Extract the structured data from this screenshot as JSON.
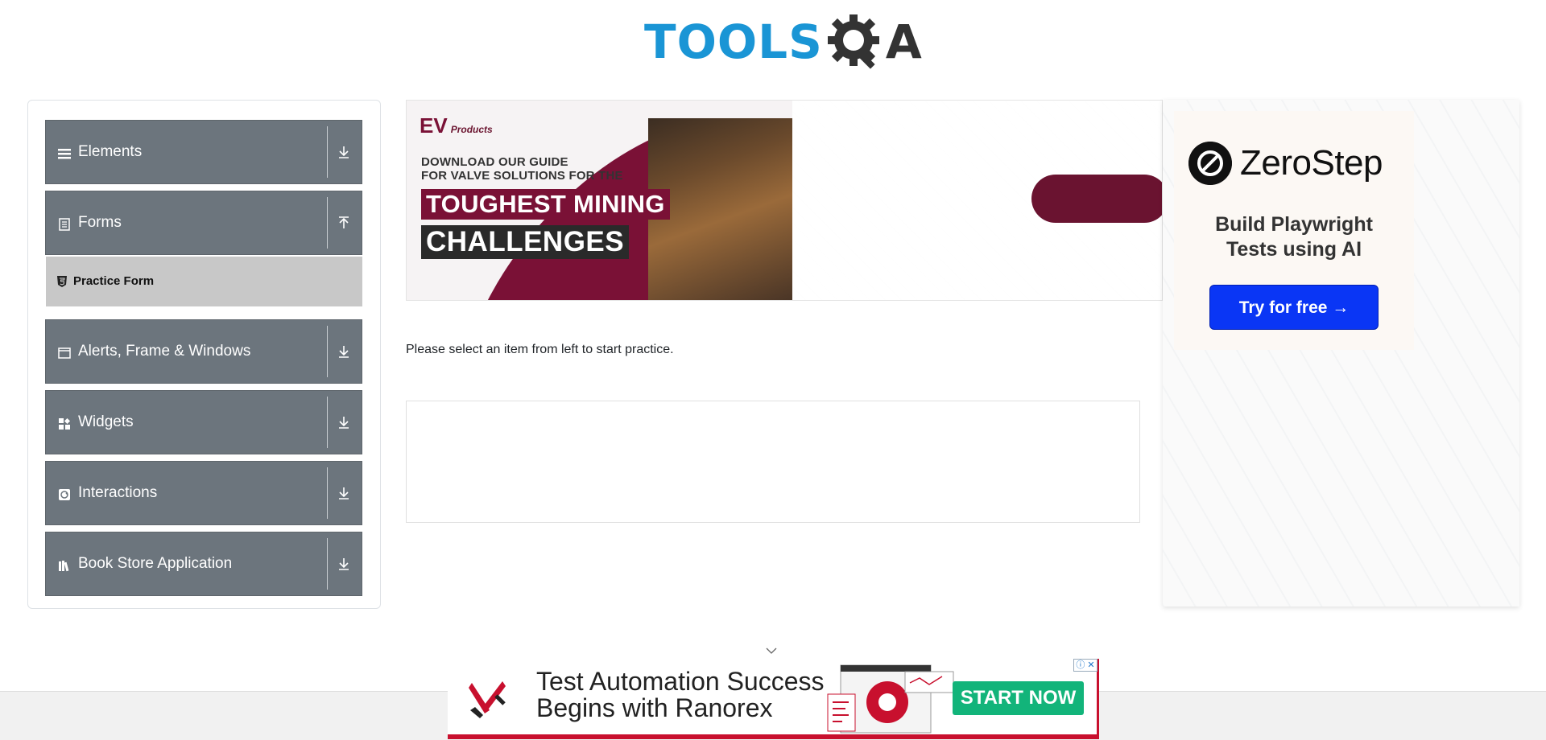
{
  "header": {
    "logo_main": "TOOLS",
    "logo_tail": "A"
  },
  "sidebar": {
    "groups": [
      {
        "label": "Elements",
        "icon": "menu-icon",
        "arrow": "download-arrow"
      },
      {
        "label": "Forms",
        "icon": "document-icon",
        "arrow": "upload-arrow"
      },
      {
        "label": "Alerts, Frame & Windows",
        "icon": "window-icon",
        "arrow": "download-arrow"
      },
      {
        "label": "Widgets",
        "icon": "grid-icon",
        "arrow": "download-arrow"
      },
      {
        "label": "Interactions",
        "icon": "interaction-icon",
        "arrow": "download-arrow"
      },
      {
        "label": "Book Store Application",
        "icon": "book-icon",
        "arrow": "download-arrow"
      }
    ],
    "forms_subitem": {
      "label": "Practice Form",
      "icon": "html5-icon"
    }
  },
  "ad_top": {
    "brand": "Products",
    "brand_mark": "EV",
    "line1": "DOWNLOAD OUR GUIDE",
    "line2": "FOR VALVE SOLUTIONS FOR THE",
    "headline1": "TOUGHEST MINING",
    "headline2": "CHALLENGES"
  },
  "ad_right": {
    "brand": "ZeroStep",
    "tagline_1": "Build Playwright",
    "tagline_2": "Tests using AI",
    "cta": "Try for free →"
  },
  "main": {
    "instruction": "Please select an item from left to start practice."
  },
  "ad_bottom": {
    "line1": "Test Automation Success",
    "line2": "Begins with Ranorex",
    "cta": "START NOW",
    "close": "ⓘ ✕"
  },
  "colors": {
    "sidebar_group_bg": "#6c757d",
    "subitem_bg": "#c8c8c8",
    "logo_blue": "#1a95d5",
    "ad_maroon": "#7a1136",
    "zerostep_button": "#0a36f5",
    "ranorex_button": "#12b47a"
  }
}
